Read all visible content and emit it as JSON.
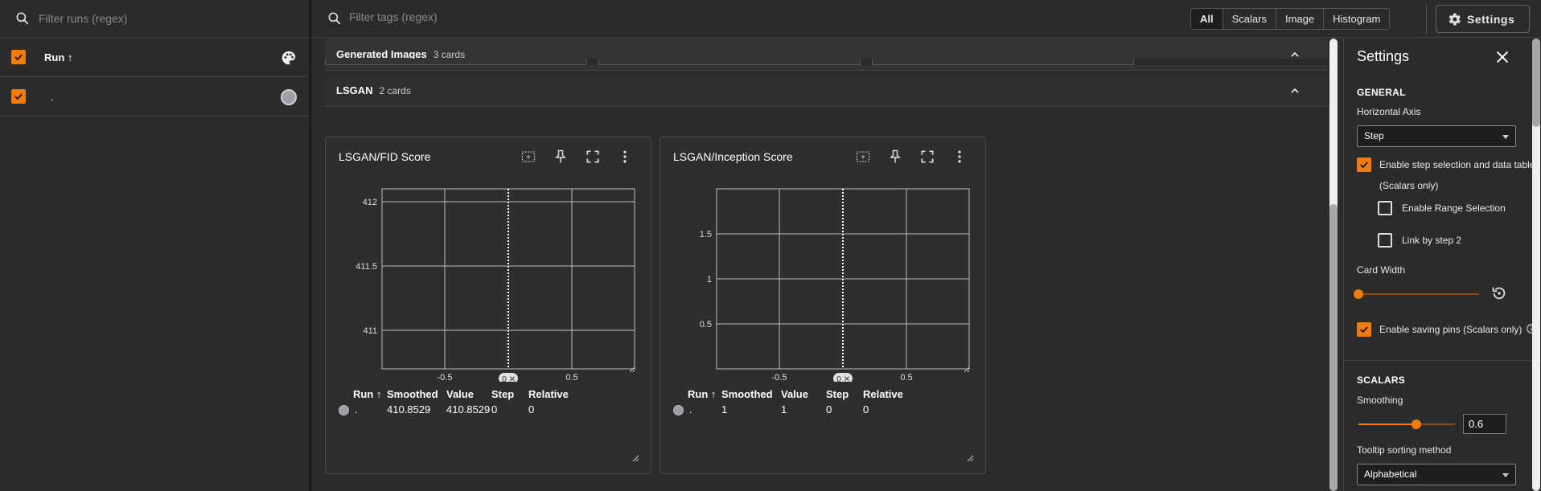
{
  "runs_panel": {
    "filter_placeholder": "Filter runs (regex)",
    "header_label": "Run",
    "sort_arrow": "↑",
    "runs": [
      {
        "name": ".",
        "checked": true,
        "color": "#9aa0a6"
      }
    ]
  },
  "topbar": {
    "filter_placeholder": "Filter tags (regex)",
    "type_filters": [
      "All",
      "Scalars",
      "Image",
      "Histogram"
    ],
    "active_type": "All",
    "settings_label": "Settings"
  },
  "groups": [
    {
      "title": "Generated Images",
      "count": "3 cards"
    },
    {
      "title": "LSGAN",
      "count": "2 cards"
    }
  ],
  "cards": [
    {
      "title": "LSGAN/FID Score",
      "x_ticks": [
        "-0.5",
        "0.5"
      ],
      "y_ticks": [
        "412",
        "411.5",
        "411"
      ],
      "step_chip": "0",
      "table_headers": [
        "Run",
        "Smoothed",
        "Value",
        "Step",
        "Relative"
      ],
      "sort_arrow": "↑",
      "row": {
        "run": ".",
        "smoothed": "410.8529",
        "value": "410.8529",
        "step": "0",
        "relative": "0"
      }
    },
    {
      "title": "LSGAN/Inception Score",
      "x_ticks": [
        "-0.5",
        "0.5"
      ],
      "y_ticks": [
        "1.5",
        "1",
        "0.5"
      ],
      "step_chip": "0",
      "table_headers": [
        "Run",
        "Smoothed",
        "Value",
        "Step",
        "Relative"
      ],
      "sort_arrow": "↑",
      "row": {
        "run": ".",
        "smoothed": "1",
        "value": "1",
        "step": "0",
        "relative": "0"
      }
    }
  ],
  "settings": {
    "title": "Settings",
    "general_heading": "GENERAL",
    "horizontal_axis_label": "Horizontal Axis",
    "horizontal_axis_value": "Step",
    "enable_step_selection": "Enable step selection and data table",
    "scalars_only": "(Scalars only)",
    "enable_range_selection": "Enable Range Selection",
    "link_by_step": "Link by step 2",
    "card_width_label": "Card Width",
    "enable_saving_pins": "Enable saving pins (Scalars only)",
    "scalars_heading": "SCALARS",
    "smoothing_label": "Smoothing",
    "smoothing_value": "0.6",
    "smoothing_fraction": 0.6,
    "tooltip_sort_label": "Tooltip sorting method",
    "tooltip_sort_value": "Alphabetical"
  },
  "colors": {
    "accent": "#f57c00",
    "background": "#2b2b2b",
    "run_color": "#9aa0a6"
  }
}
